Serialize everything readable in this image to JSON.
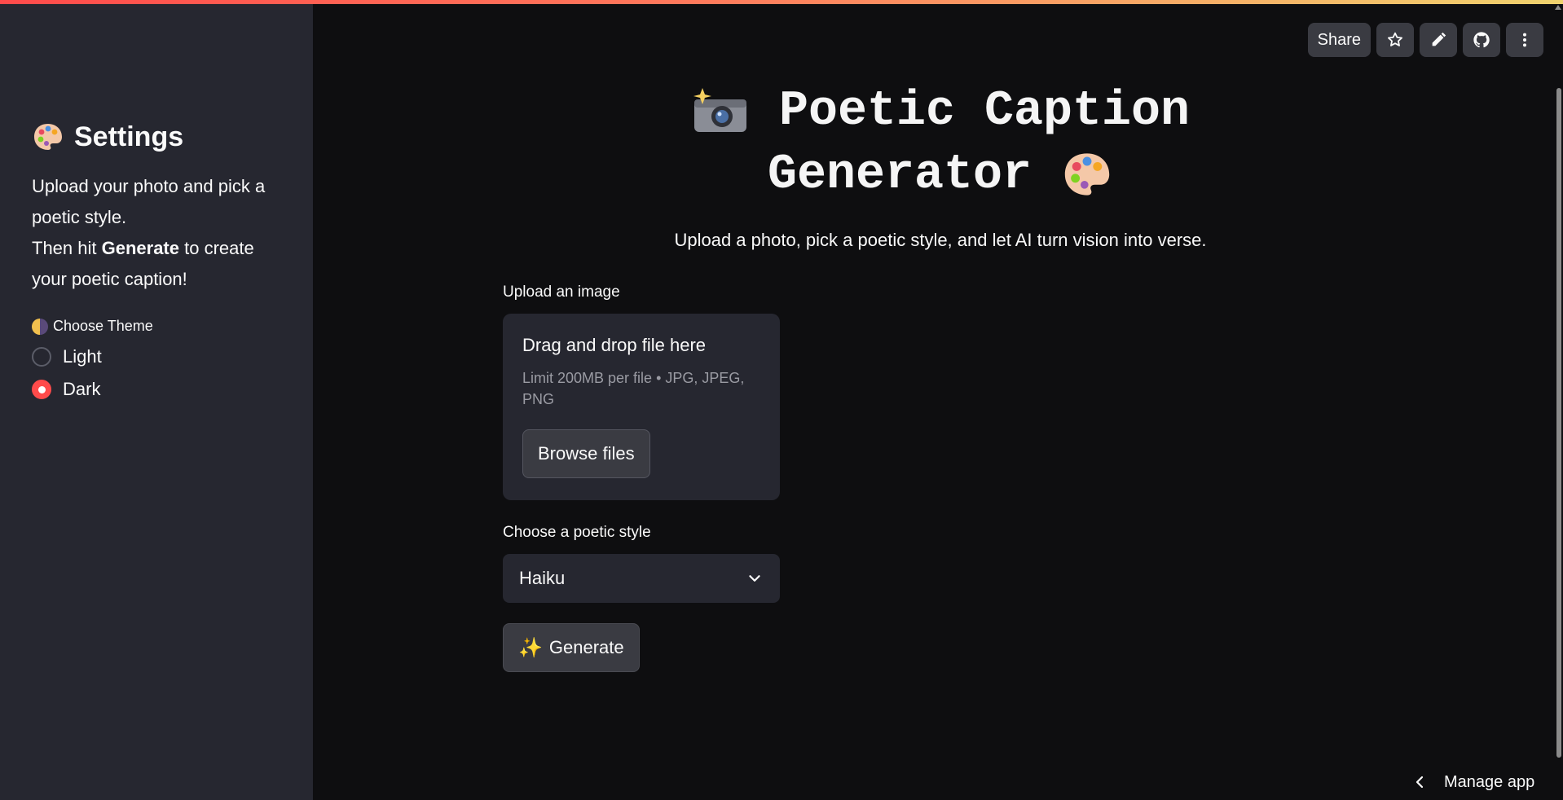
{
  "sidebar": {
    "title": "Settings",
    "description_lines": {
      "line1": "Upload your photo and pick a poetic style.",
      "line2_prefix": "Then hit ",
      "line2_bold": "Generate",
      "line2_suffix": " to create your poetic caption!"
    },
    "theme_label": "Choose Theme",
    "theme_options": [
      "Light",
      "Dark"
    ],
    "theme_selected": "Dark"
  },
  "toolbar": {
    "share_label": "Share",
    "icons": [
      "star-icon",
      "pencil-icon",
      "github-icon",
      "more-vertical-icon"
    ]
  },
  "main": {
    "title_line1": "Poetic Caption",
    "title_line2": "Generator",
    "subtitle": "Upload a photo, pick a poetic style, and let AI turn vision into verse.",
    "upload_label": "Upload an image",
    "dropzone_title": "Drag and drop file here",
    "dropzone_limit": "Limit 200MB per file • JPG, JPEG, PNG",
    "browse_label": "Browse files",
    "style_label": "Choose a poetic style",
    "style_selected": "Haiku",
    "generate_label": "Generate"
  },
  "footer": {
    "manage_app_label": "Manage app"
  },
  "colors": {
    "background": "#0e0e10",
    "sidebar": "#262730",
    "accent": "#ff4b4b",
    "button": "#3a3b42"
  }
}
